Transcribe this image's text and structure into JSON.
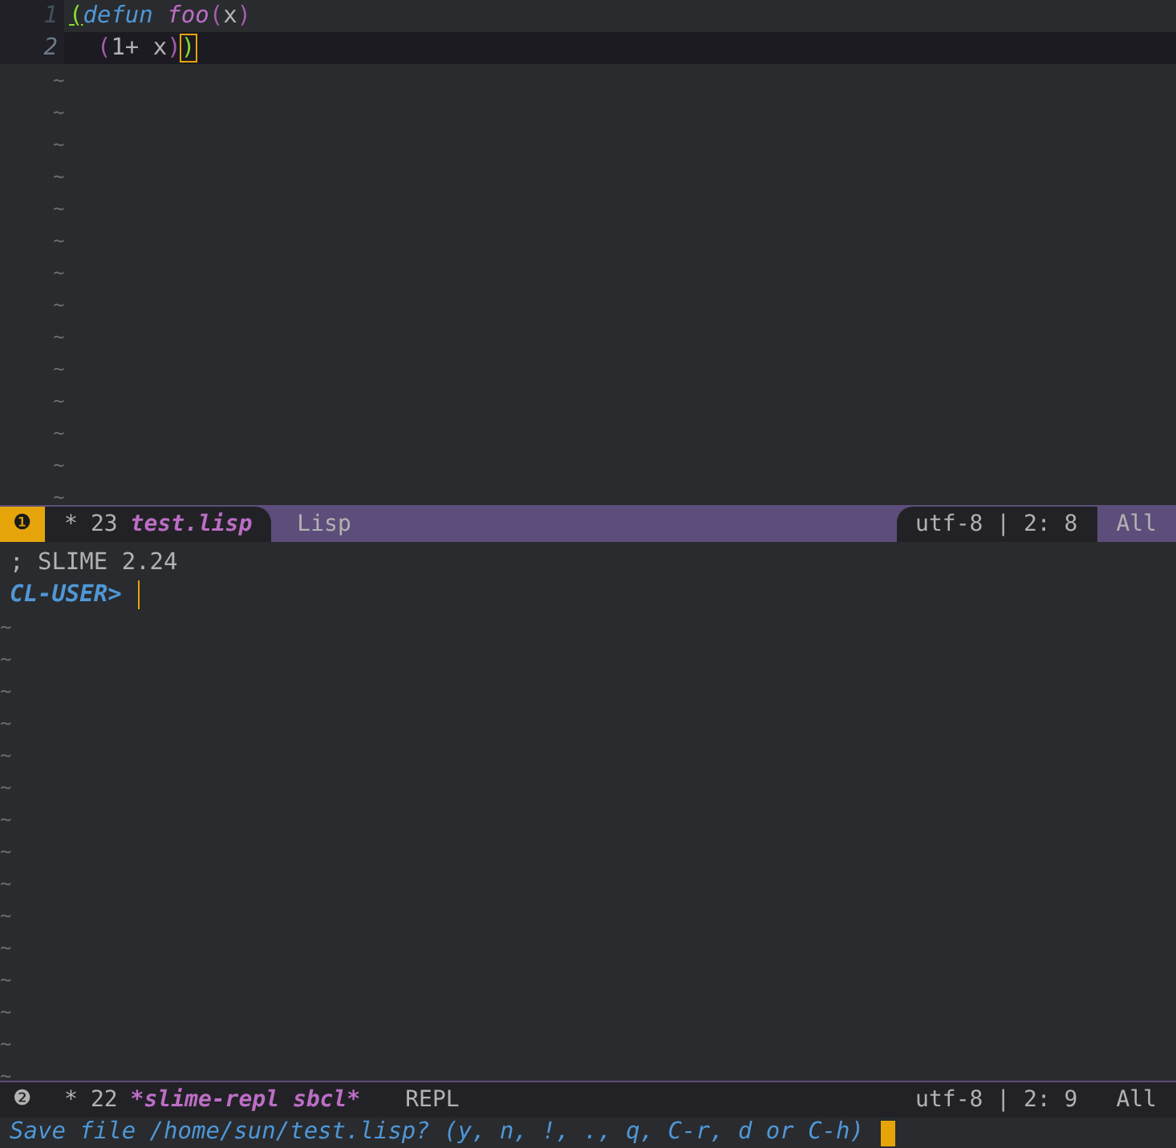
{
  "editor_pane": {
    "lines": [
      {
        "number": "1",
        "current": false,
        "tokens": [
          {
            "kind": "match-paren",
            "text": "("
          },
          {
            "kind": "keyword",
            "text": "defun "
          },
          {
            "kind": "function",
            "text": "foo"
          },
          {
            "kind": "paren",
            "text": "("
          },
          {
            "kind": "text",
            "text": "x"
          },
          {
            "kind": "paren",
            "text": ")"
          }
        ]
      },
      {
        "number": "2",
        "current": true,
        "tokens": [
          {
            "kind": "paren",
            "text": "  ("
          },
          {
            "kind": "text",
            "text": "1+ x"
          },
          {
            "kind": "paren",
            "text": ")"
          },
          {
            "kind": "cursor-paren",
            "text": ")"
          }
        ]
      }
    ],
    "empty_line_markers": [
      "~",
      "~",
      "~",
      "~",
      "~",
      "~",
      "~",
      "~",
      "~",
      "~",
      "~",
      "~",
      "~",
      "~"
    ]
  },
  "editor_mode_line": {
    "window_number": "❶",
    "active": true,
    "modified": "*",
    "size": "23",
    "buffer_name": "test.lisp",
    "major_mode": "Lisp",
    "encoding": "utf-8 | 2: 8",
    "position": "All"
  },
  "repl_pane": {
    "banner": "; SLIME 2.24",
    "prompt": "CL-USER>",
    "empty_line_markers": [
      "~",
      "~",
      "~",
      "~",
      "~",
      "~",
      "~",
      "~",
      "~",
      "~",
      "~",
      "~",
      "~",
      "~",
      "~"
    ]
  },
  "repl_mode_line": {
    "window_number": "❷",
    "active": false,
    "modified": "*",
    "size": "22",
    "buffer_name": "*slime-repl sbcl*",
    "major_mode": "REPL",
    "encoding": "utf-8 | 2: 9",
    "position": "All"
  },
  "minibuffer": {
    "prompt": "Save file /home/sun/test.lisp? (y, n, !, ., q, C-r, d or C-h)"
  }
}
